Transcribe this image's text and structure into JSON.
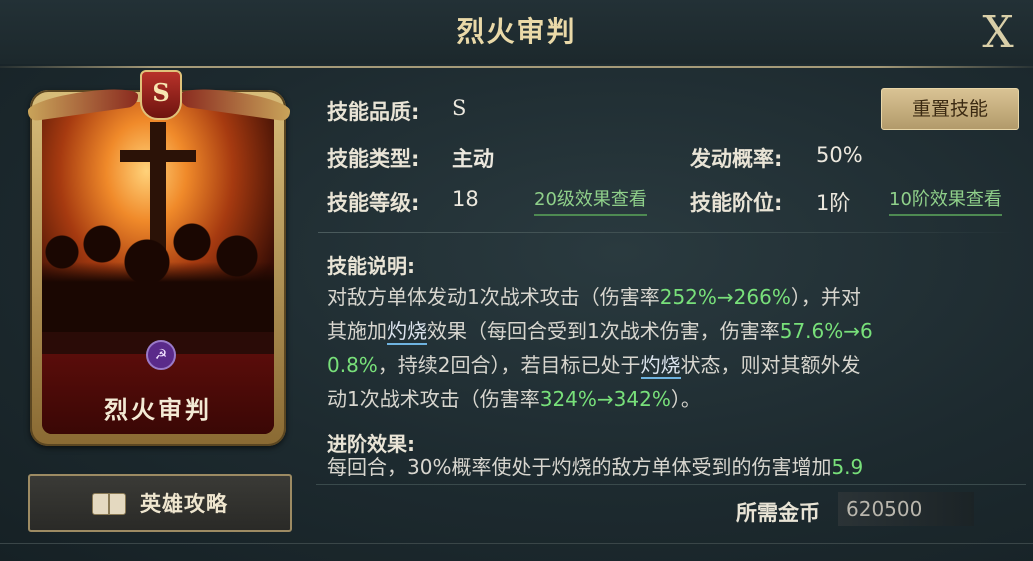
{
  "window": {
    "title": "烈火审判",
    "close_label": "X"
  },
  "card": {
    "grade": "S",
    "name": "烈火审判"
  },
  "guide_button": {
    "label": "英雄攻略"
  },
  "skill": {
    "quality_label": "技能品质:",
    "quality_value": "S",
    "type_label": "技能类型:",
    "type_value": "主动",
    "level_label": "技能等级:",
    "level_value": "18",
    "level_link": "20级效果查看",
    "chance_label": "发动概率:",
    "chance_value": "50%",
    "tier_label": "技能阶位:",
    "tier_value": "1阶",
    "tier_link": "10阶效果查看",
    "reset_label": "重置技能"
  },
  "description": {
    "heading": "技能说明:",
    "l1_a": "对敌方单体发动1次战术攻击（伤害率",
    "l1_hl": "252%→266%",
    "l1_b": "），并对",
    "l2_a": "其施加",
    "kw_burn": "灼烧",
    "l2_b": "效果（每回合受到1次战术伤害，伤害率",
    "l2_hl": "57.6%→6",
    "l3_hl": "0.8%",
    "l3_a": "，持续2回合），若目标已处于",
    "l3_b": "状态，则对其额外发",
    "l4_a": "动1次战术攻击（伤害率",
    "l4_hl": "324%→342%",
    "l4_b": "）。"
  },
  "advance": {
    "heading": "进阶效果:",
    "text_a": "每回合，30%概率使处于灼烧的敌方单体受到的伤害增加",
    "text_hl": "5.9"
  },
  "cost": {
    "label": "所需金币",
    "value": "620500"
  },
  "colors": {
    "accent_green": "#78e07a",
    "title_gold": "#ead9a8",
    "keyword_underline": "#6fb3e0"
  }
}
